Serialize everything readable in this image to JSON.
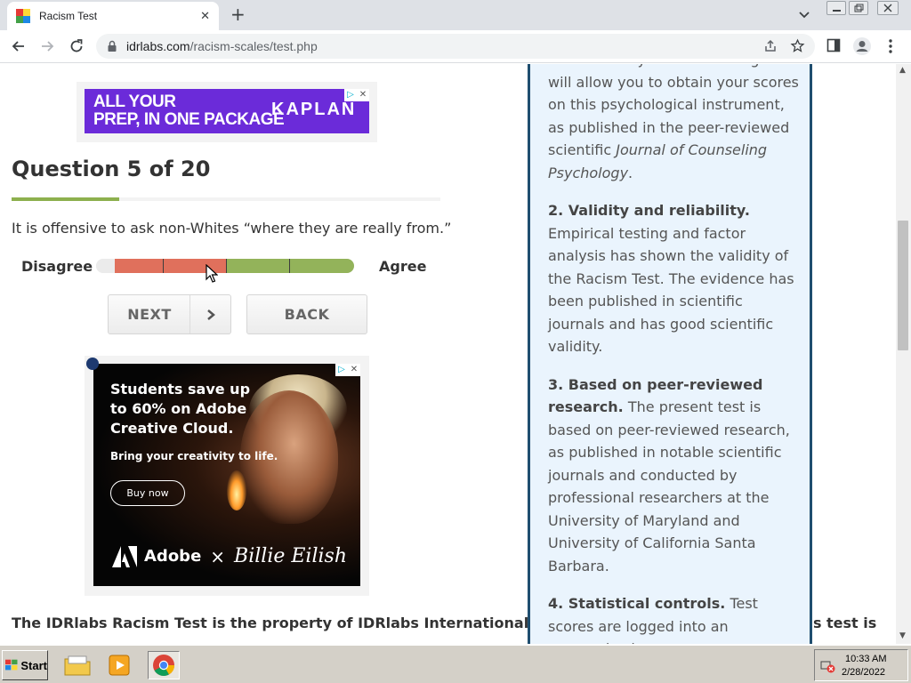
{
  "browser": {
    "tab_title": "Racism Test",
    "tab_close_glyph": "✕",
    "new_tab_glyph": "+",
    "url_host": "idrlabs.com",
    "url_path": "/racism-scales/test.php"
  },
  "ads": {
    "top_banner_text": "ALL YOUR\nPREP, IN ONE PACKAGE",
    "top_banner_brand": "KAPLAN",
    "adobe_headline": "Students save up to 60% on Adobe Creative Cloud.",
    "adobe_sub": "Bring your creativity to life.",
    "adobe_button": "Buy now",
    "adobe_brand": "Adobe",
    "adobe_times": "×",
    "adobe_partner": "Billie Eilish"
  },
  "quiz": {
    "title": "Question 5 of 20",
    "progress_fraction": 0.25,
    "question": "It is offensive to ask non-Whites “where they are really from.”",
    "disagree_label": "Disagree",
    "agree_label": "Agree",
    "next_label": "NEXT",
    "back_label": "BACK"
  },
  "ownership_text": "The IDRlabs Racism Test is the property of IDRlabs International. The original research on which this test is",
  "sidebar": {
    "p1_text": "delivered to you free of charge and will allow you to obtain your scores on this psychological instrument, as published in the peer-reviewed scientific ",
    "p1_journal": "Journal of Counseling Psychology",
    "p1_end": ".",
    "p2_head": "2. Validity and reliability.",
    "p2_text": " Empirical testing and factor analysis has shown the validity of the Racism Test. The evidence has been published in scientific journals and has good scientific validity.",
    "p3_head": "3. Based on peer-reviewed research.",
    "p3_text": " The present test is based on peer-reviewed research, as published in notable scientific journals and conducted by professional researchers at the University of Maryland and University of California Santa Barbara.",
    "p4_head": "4. Statistical controls.",
    "p4_text": " Test scores are logged into an anonymized"
  },
  "taskbar": {
    "start_label": "Start",
    "clock_time": "10:33 AM",
    "clock_date": "2/28/2022"
  },
  "colors": {
    "scale_red": "#e0705c",
    "scale_green": "#93b35a",
    "accent_green": "#8db04e",
    "sidebar_border": "#1f4e6f",
    "kaplan_purple": "#6b2bd9"
  }
}
